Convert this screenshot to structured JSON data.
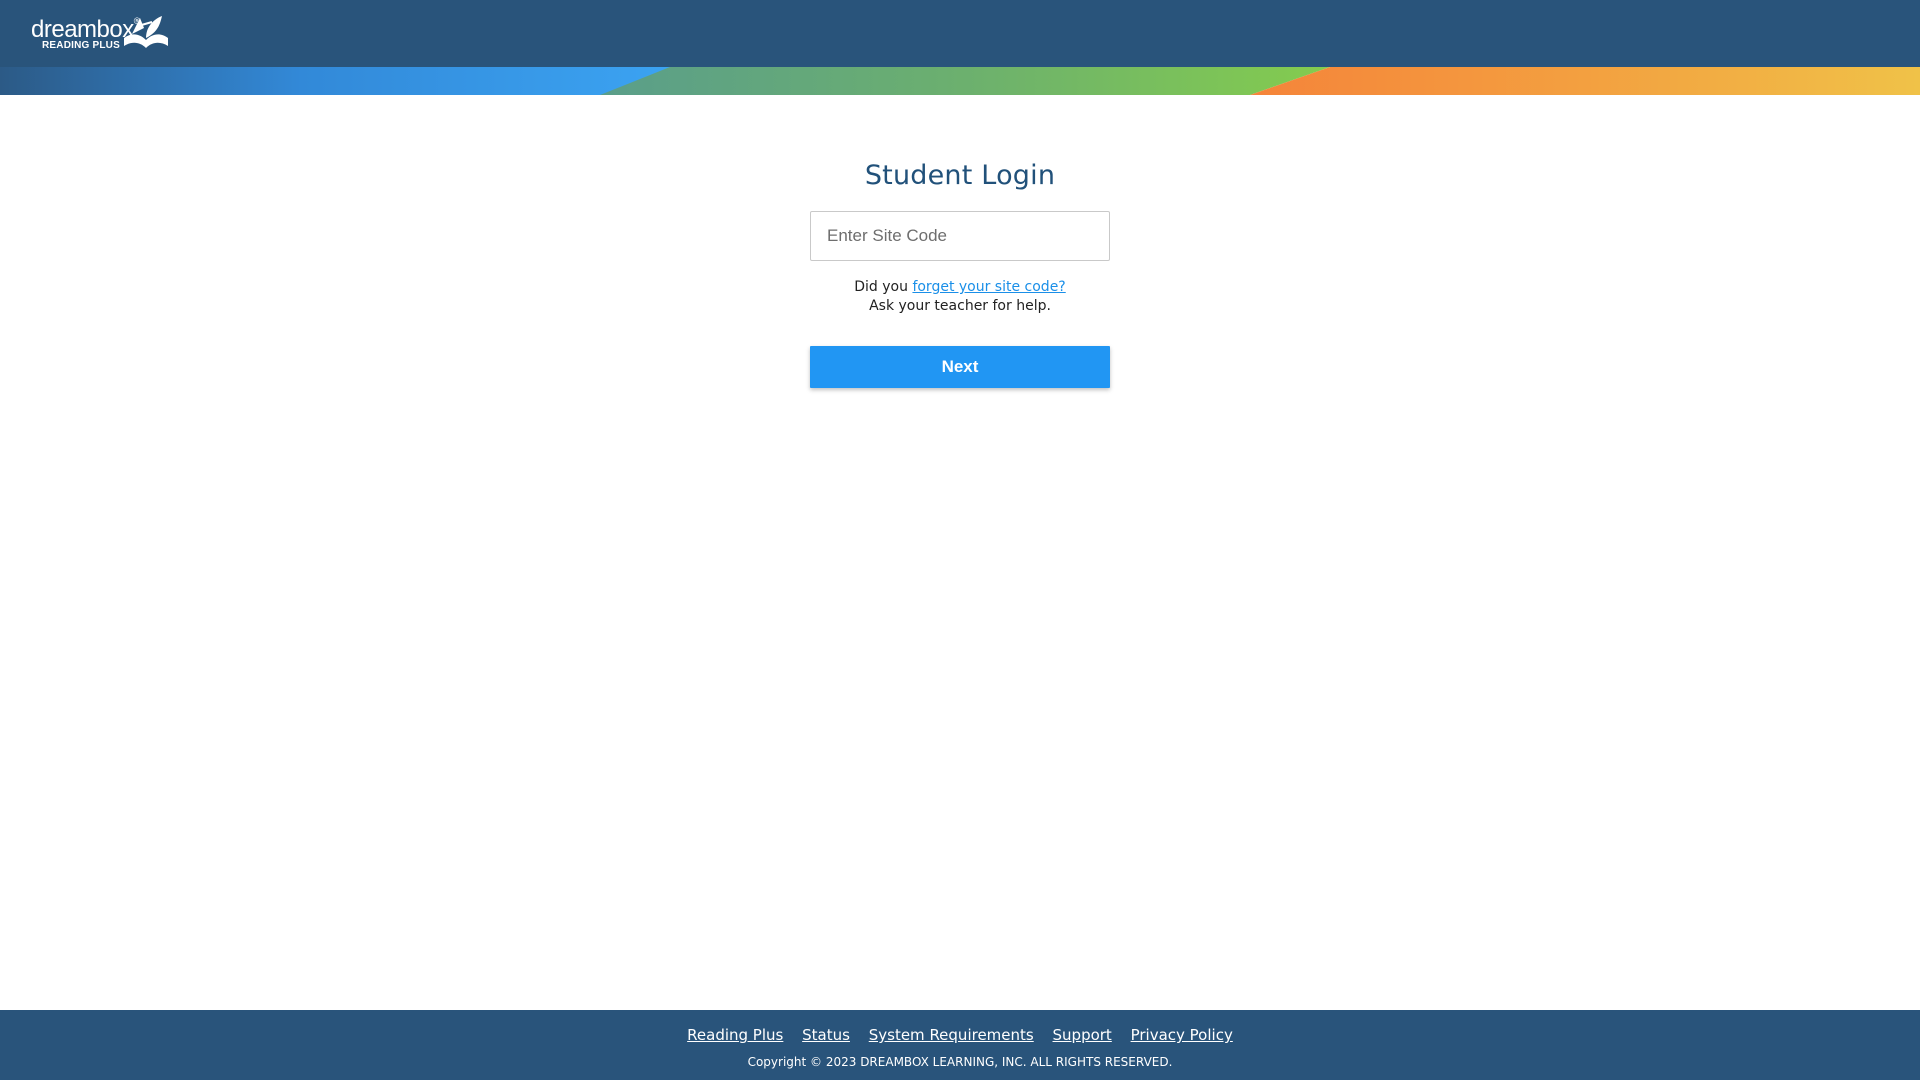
{
  "header": {
    "logo_word": "dreambox",
    "logo_tm": "®",
    "logo_sub": "READING PLUS"
  },
  "login": {
    "title": "Student Login",
    "site_code_placeholder": "Enter Site Code",
    "site_code_value": "",
    "help_prefix": "Did you ",
    "help_link": "forget your site code?",
    "help_line2": "Ask your teacher for help.",
    "next_label": "Next"
  },
  "footer": {
    "links": [
      "Reading Plus",
      "Status",
      "System Requirements",
      "Support",
      "Privacy Policy"
    ],
    "copyright": "Copyright © 2023 DREAMBOX LEARNING, INC. ALL RIGHTS RESERVED."
  },
  "colors": {
    "header_bg": "#29547b",
    "button": "#2196f3",
    "title": "#21517a",
    "link": "#1a8fe8",
    "band_blue": "#3aa0f0",
    "band_green": "#7dc855",
    "band_orange": "#f58a3a",
    "band_yellow": "#f0bf45"
  }
}
